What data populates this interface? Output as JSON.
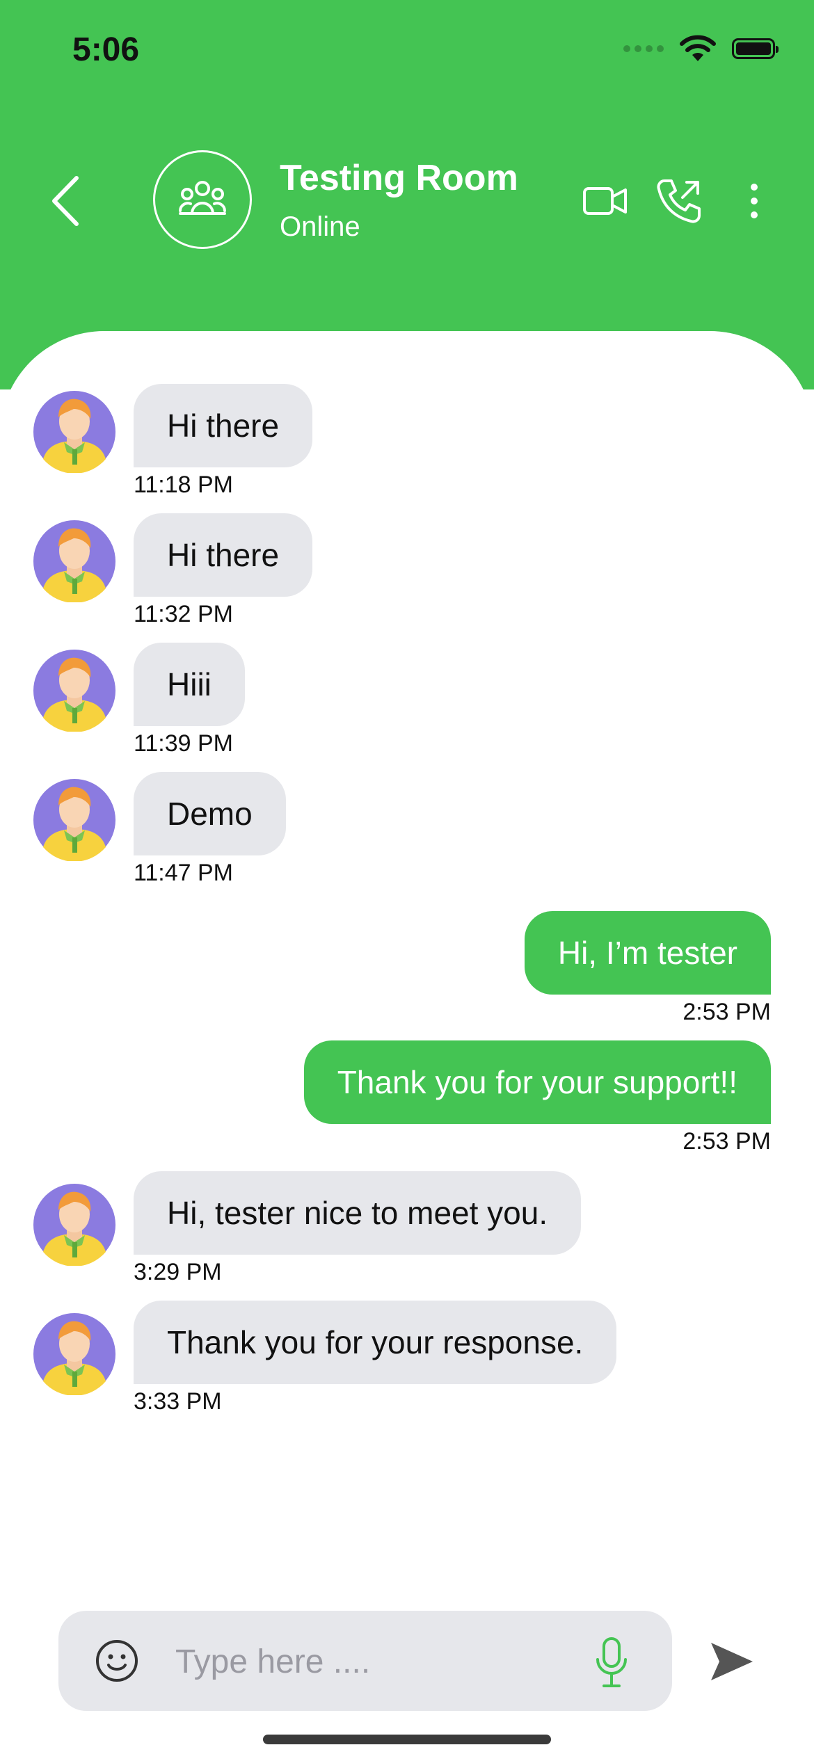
{
  "status_bar": {
    "time": "5:06"
  },
  "header": {
    "title": "Testing Room",
    "status": "Online",
    "icons": {
      "back": "chevron-left-icon",
      "group": "group-icon",
      "video": "video-camera-icon",
      "call": "phone-outgoing-icon",
      "more": "more-vertical-icon"
    }
  },
  "messages": [
    {
      "direction": "incoming",
      "text": "Hi there",
      "time": "11:18 PM"
    },
    {
      "direction": "incoming",
      "text": "Hi there",
      "time": "11:32 PM"
    },
    {
      "direction": "incoming",
      "text": "Hiii",
      "time": "11:39 PM"
    },
    {
      "direction": "incoming",
      "text": "Demo",
      "time": "11:47 PM"
    },
    {
      "direction": "outgoing",
      "text": "Hi, I’m tester",
      "time": "2:53 PM"
    },
    {
      "direction": "outgoing",
      "text": "Thank you for your support!!",
      "time": "2:53 PM"
    },
    {
      "direction": "incoming",
      "text": "Hi, tester nice to meet you.",
      "time": "3:29 PM"
    },
    {
      "direction": "incoming",
      "text": "Thank you for your response.",
      "time": "3:33 PM"
    }
  ],
  "composer": {
    "placeholder": "Type here ....",
    "value": "",
    "icons": {
      "emoji": "emoji-icon",
      "mic": "microphone-icon",
      "send": "send-icon"
    }
  },
  "colors": {
    "accent": "#44C453",
    "incoming_bubble": "#E6E7EB",
    "input_bg": "#E6E7EB"
  }
}
